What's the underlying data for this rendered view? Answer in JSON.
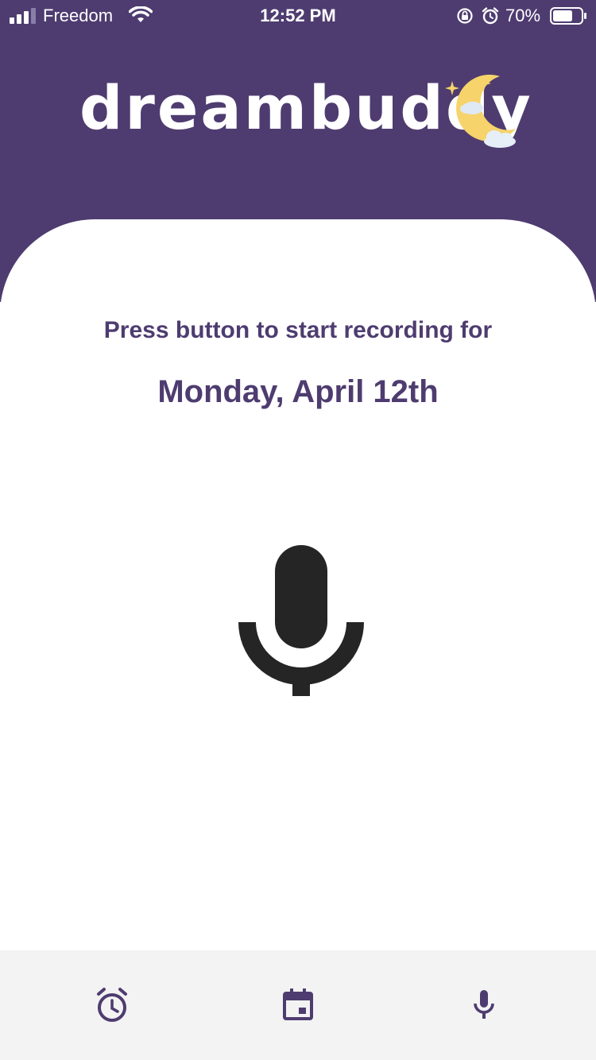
{
  "status_bar": {
    "carrier": "Freedom",
    "time": "12:52 PM",
    "battery_percent": "70%",
    "battery_level": 0.7,
    "icons": [
      "signal-icon",
      "wifi-icon",
      "lock-rotation-icon",
      "alarm-icon",
      "battery-icon"
    ]
  },
  "header": {
    "logo_text": "dreambuddy",
    "logo_icon": "crescent-moon-icon",
    "background_color": "#4e3c70"
  },
  "main": {
    "prompt": "Press button to start recording for",
    "date": "Monday, April 12th",
    "record_icon": "microphone-icon",
    "text_color": "#4e3c70"
  },
  "tab_bar": {
    "tabs": [
      {
        "icon": "alarm-clock-icon"
      },
      {
        "icon": "calendar-icon"
      },
      {
        "icon": "microphone-icon"
      }
    ],
    "background_color": "#f3f3f3",
    "icon_color": "#4e3c70"
  }
}
